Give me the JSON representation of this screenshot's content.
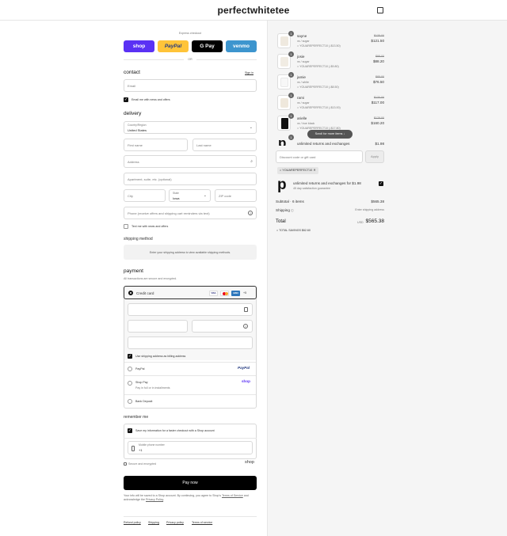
{
  "brand": "perfectwhitetee",
  "express": {
    "title": "Express checkout",
    "buttons": [
      "shop",
      "PayPal",
      "G Pay",
      "venmo"
    ],
    "or": "OR"
  },
  "contact": {
    "title": "contact",
    "sign_in": "Sign in",
    "email_placeholder": "Email",
    "email_opt_in": "Email me with news and offers"
  },
  "delivery": {
    "title": "delivery",
    "country_label": "Country/Region",
    "country_value": "United States",
    "first_name": "First name",
    "last_name": "Last name",
    "address": "Address",
    "apartment": "Apartment, suite, etc. (optional)",
    "city": "City",
    "state_label": "State",
    "state_value": "Iowa",
    "zip": "ZIP code",
    "phone": "Phone (receive offers and shipping cart reminders via text)",
    "text_opt_in": "Text me with news and offers"
  },
  "shipping_method": {
    "title": "shipping method",
    "message": "Enter your shipping address to view available shipping methods."
  },
  "payment": {
    "title": "payment",
    "subtitle": "All transactions are secure and encrypted.",
    "credit_card": "Credit card",
    "card_badges": [
      "VISA",
      "MC",
      "AMEX",
      "+5"
    ],
    "billing_same": "Use shipping address as billing address",
    "paypal": "PayPal",
    "paypal_logo": "PayPal",
    "shop_pay": "Shop Pay",
    "shop_pay_sub": "Pay in full or in installments",
    "shop_logo": "shop",
    "bank_deposit": "Bank Deposit"
  },
  "remember": {
    "title": "remember me",
    "save_info": "Save my information for a faster checkout with a Shop account",
    "phone_label": "Mobile phone number",
    "phone_value": "+1",
    "secure": "Secure and encrypted",
    "shop_logo": "shop"
  },
  "pay_now": "Pay now",
  "legal": {
    "text": "Your info will be saved to a Shop account. By continuing, you agree to Shop's",
    "terms": "Terms of Service",
    "and": "and acknowledge the",
    "privacy": "Privacy Policy",
    "period": "."
  },
  "footer_links": [
    "Refund policy",
    "Shipping",
    "Privacy policy",
    "Terms of service"
  ],
  "cart": {
    "items": [
      {
        "name": "sayne",
        "variant": "xs / sugar",
        "discount": "YOUAREPERFECT10 (-$13.50)",
        "compare": "$135.00",
        "price": "$121.50",
        "qty": "1",
        "swatch": "#efe9df"
      },
      {
        "name": "josie",
        "variant": "xs / sugar",
        "discount": "YOUAREPERFECT10 (-$9.80)",
        "compare": "$98.00",
        "price": "$88.20",
        "qty": "1",
        "swatch": "#f1ece3"
      },
      {
        "name": "jamie",
        "variant": "xs / white",
        "discount": "YOUAREPERFECT10 (-$8.50)",
        "compare": "$85.00",
        "price": "$76.50",
        "qty": "1",
        "swatch": "#f7f7f7"
      },
      {
        "name": "rami",
        "variant": "xs / sugar",
        "discount": "YOUAREPERFECT10 (-$13.00)",
        "compare": "$130.00",
        "price": "$117.00",
        "qty": "1",
        "swatch": "#efe8dc"
      },
      {
        "name": "arielle",
        "variant": "xs / true black",
        "discount": "YOUAREPERFECT10 (-$17.80)",
        "compare": "$178.00",
        "price": "$160.20",
        "qty": "1",
        "swatch": "#111111"
      }
    ],
    "partial_item": {
      "name": "unlimited returns and exchanges",
      "price": "$1.98",
      "qty": "1"
    },
    "scroll_hint": "Scroll for more items",
    "discount_placeholder": "Discount code or gift card",
    "apply": "Apply",
    "applied_code": "YOUAREPERFECT10",
    "upsell_title": "unlimited returns and exchanges for $1.98",
    "upsell_sub": "45 day satisfaction guarantee",
    "subtotal_label": "Subtotal · 6 items",
    "subtotal_value": "$565.38",
    "shipping_label": "Shipping",
    "shipping_value": "Enter shipping address",
    "total_label": "Total",
    "currency": "USD",
    "total_value": "$565.38",
    "savings": "TOTAL SAVINGS  $62.60"
  }
}
